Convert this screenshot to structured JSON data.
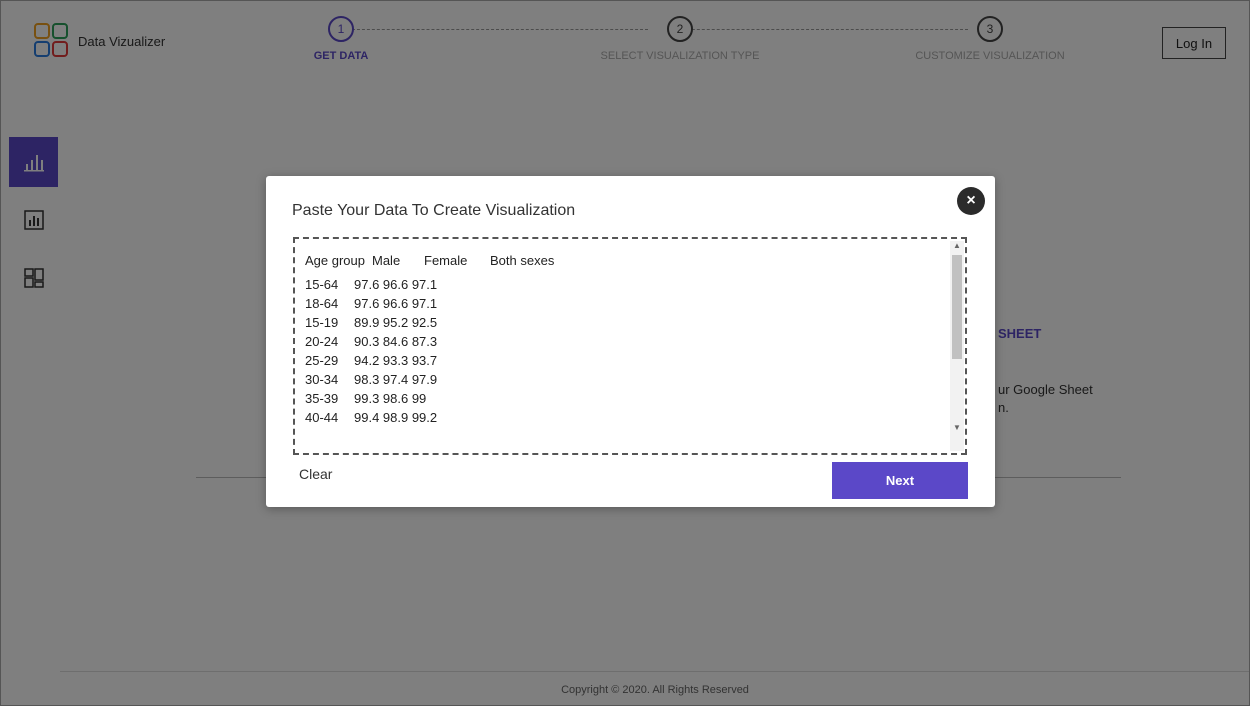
{
  "app": {
    "name": "Data Vizualizer"
  },
  "steps": [
    {
      "number": "1",
      "label": "GET DATA",
      "active": true
    },
    {
      "number": "2",
      "label": "SELECT VISUALIZATION TYPE",
      "active": false
    },
    {
      "number": "3",
      "label": "CUSTOMIZE VISUALIZATION",
      "active": false
    }
  ],
  "header": {
    "login_label": "Log In"
  },
  "sidebar": {
    "icons": [
      "bar-chart-icon",
      "report-icon",
      "dashboard-icon"
    ]
  },
  "background": {
    "heading_fragment": "SHEET",
    "text_line1": "ur Google Sheet",
    "text_line2": "n."
  },
  "modal": {
    "title": "Paste Your Data To Create Visualization",
    "close_symbol": "×",
    "columns": [
      "Age group",
      "Male",
      "Female",
      "Both sexes"
    ],
    "rows": [
      {
        "age": "15-64",
        "values": "97.6 96.6 97.1"
      },
      {
        "age": "18-64",
        "values": "97.6 96.6 97.1"
      },
      {
        "age": "15-19",
        "values": "89.9 95.2 92.5"
      },
      {
        "age": "20-24",
        "values": "90.3 84.6 87.3"
      },
      {
        "age": "25-29",
        "values": "94.2 93.3 93.7"
      },
      {
        "age": "30-34",
        "values": "98.3 97.4 97.9"
      },
      {
        "age": "35-39",
        "values": "99.3 98.6 99"
      },
      {
        "age": "40-44",
        "values": "99.4 98.9 99.2"
      }
    ],
    "clear_label": "Clear",
    "next_label": "Next"
  },
  "footer": {
    "copyright": "Copyright © 2020. All Rights Reserved"
  },
  "colors": {
    "accent": "#5b48c8",
    "overlay": "rgba(0,0,0,0.5)"
  }
}
